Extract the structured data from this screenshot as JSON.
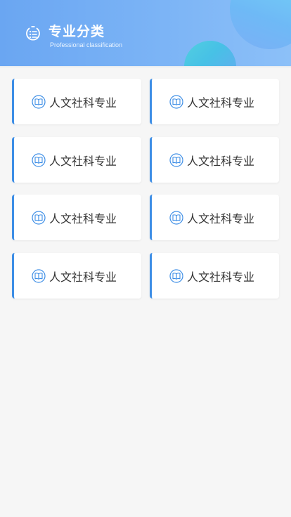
{
  "header": {
    "title": "专业分类",
    "subtitle": "Professional classification",
    "icon": "list-badge-icon",
    "gradient_start": "#6aa6f2",
    "gradient_end": "#8cc0f8"
  },
  "categories": [
    {
      "label": "人文社科专业",
      "icon": "book-icon"
    },
    {
      "label": "人文社科专业",
      "icon": "book-icon"
    },
    {
      "label": "人文社科专业",
      "icon": "book-icon"
    },
    {
      "label": "人文社科专业",
      "icon": "book-icon"
    },
    {
      "label": "人文社科专业",
      "icon": "book-icon"
    },
    {
      "label": "人文社科专业",
      "icon": "book-icon"
    },
    {
      "label": "人文社科专业",
      "icon": "book-icon"
    },
    {
      "label": "人文社科专业",
      "icon": "book-icon"
    }
  ],
  "colors": {
    "accent": "#3d8ee6",
    "background": "#f6f6f6",
    "card": "#ffffff",
    "text": "#333333"
  }
}
